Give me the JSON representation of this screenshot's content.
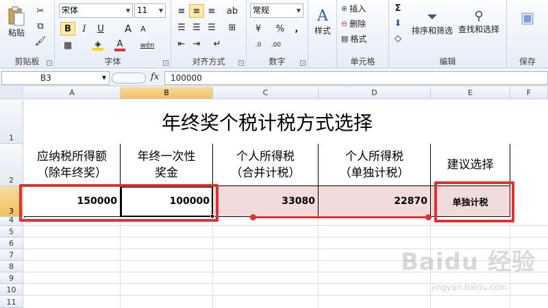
{
  "ribbon": {
    "clipboard": {
      "label": "剪贴板",
      "paste": "粘贴"
    },
    "font": {
      "label": "字体",
      "name": "宋体",
      "size": "11",
      "bold": "B",
      "italic": "I",
      "underline": "U",
      "grow": "A",
      "shrink": "A",
      "wen": "wén",
      "font_color": "#e03131",
      "fill_color": "#ffd700"
    },
    "alignment": {
      "label": "对齐方式"
    },
    "number": {
      "label": "数字",
      "format": "常规",
      "percent": "%",
      "comma": ",",
      "inc": ".0",
      "dec": ".00"
    },
    "styles": {
      "label": "样式"
    },
    "cells": {
      "label": "单元格",
      "insert": "插入",
      "delete": "删除",
      "format": "格式"
    },
    "editing": {
      "label": "编辑",
      "sum": "Σ",
      "sort": "排序和筛选",
      "find": "查找和选择"
    },
    "save": {
      "label": "保存"
    }
  },
  "formula_bar": {
    "name_box": "B3",
    "fx": "fx",
    "formula": "100000"
  },
  "grid": {
    "columns": [
      "A",
      "B",
      "C",
      "D",
      "E",
      "F"
    ],
    "rows": [
      "1",
      "2",
      "3",
      "4",
      "5",
      "6",
      "7",
      "8",
      "9",
      "10",
      "11"
    ],
    "title": "年终奖个税计税方式选择",
    "headers": [
      [
        "应纳税所得额",
        "（除年终奖）"
      ],
      [
        "年终一次性",
        "奖金"
      ],
      [
        "个人所得税",
        "（合并计税）"
      ],
      [
        "个人所得税",
        "（单独计税）"
      ],
      [
        "建议选择",
        ""
      ]
    ],
    "values": [
      "150000",
      "100000",
      "33080",
      "22870",
      "单独计税"
    ],
    "highlight_color": "#e03131"
  },
  "watermark": {
    "text": "Baidu 经验",
    "sub": "jingyan.baidu.com"
  }
}
